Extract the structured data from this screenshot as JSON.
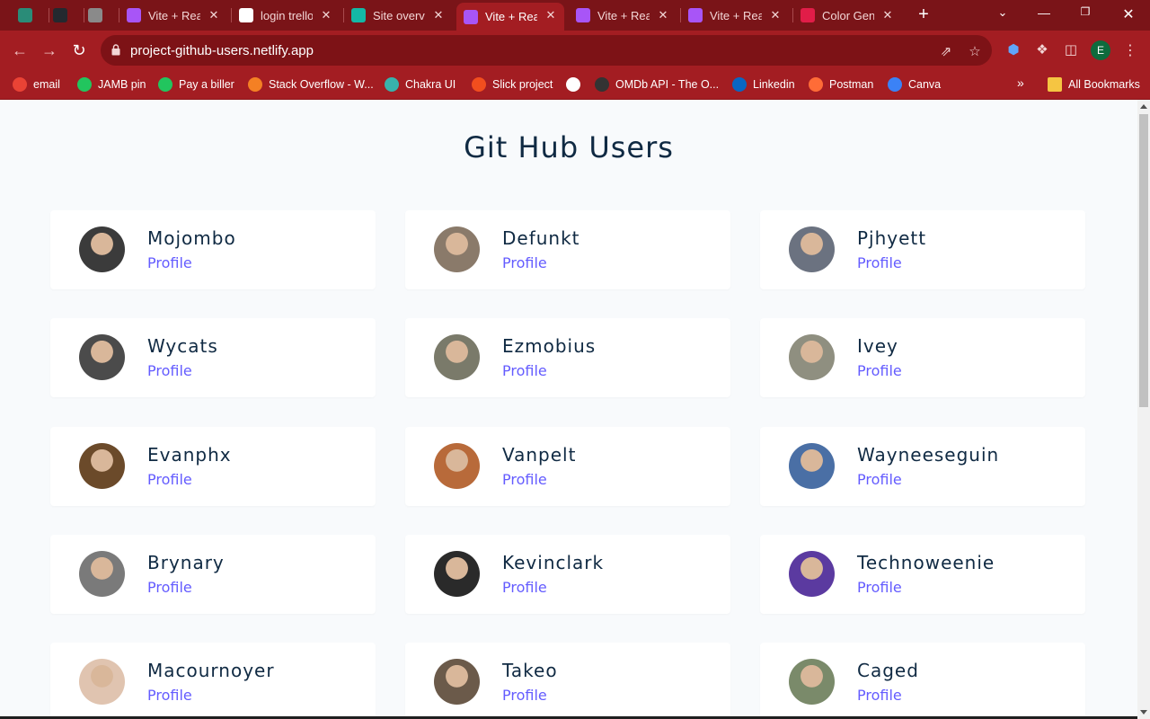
{
  "browser": {
    "tabs": [
      {
        "title": "",
        "icon": "chatgpt-icon",
        "color": "#2a8c78"
      },
      {
        "title": "",
        "icon": "github-icon",
        "color": "#24292f"
      },
      {
        "title": "",
        "icon": "app-icon",
        "color": "#8a8a8a"
      },
      {
        "title": "Vite + Reac",
        "icon": "vite-icon",
        "color": "#a855f7"
      },
      {
        "title": "login trello",
        "icon": "google-icon",
        "color": "#ffffff"
      },
      {
        "title": "Site overvie",
        "icon": "netlify-icon",
        "color": "#14b8a6"
      },
      {
        "title": "Vite + Reac",
        "icon": "vite-icon",
        "color": "#a855f7",
        "active": true
      },
      {
        "title": "Vite + Reac",
        "icon": "vite-icon",
        "color": "#a855f7"
      },
      {
        "title": "Vite + Reac",
        "icon": "vite-icon",
        "color": "#a855f7"
      },
      {
        "title": "Color Gene",
        "icon": "color-wheel-icon",
        "color": "#e11d48"
      }
    ],
    "url": "project-github-users.netlify.app",
    "profile_initial": "E",
    "bookmarks": [
      {
        "label": "email",
        "icon": "gmail-icon",
        "color": "#ea4335"
      },
      {
        "label": "JAMB pin",
        "icon": "jamb-icon",
        "color": "#22c55e"
      },
      {
        "label": "Pay a biller",
        "icon": "biller-icon",
        "color": "#22c55e"
      },
      {
        "label": "Stack Overflow - W...",
        "icon": "stackoverflow-icon",
        "color": "#f48024"
      },
      {
        "label": "Chakra UI",
        "icon": "chakra-icon",
        "color": "#38b2ac"
      },
      {
        "label": "Slick project",
        "icon": "figma-icon",
        "color": "#f24e1e"
      },
      {
        "label": "",
        "icon": "globe-icon",
        "color": "#ffffff"
      },
      {
        "label": "OMDb API - The O...",
        "icon": "omdb-icon",
        "color": "#333333"
      },
      {
        "label": "Linkedin",
        "icon": "linkedin-icon",
        "color": "#0a66c2"
      },
      {
        "label": "Postman",
        "icon": "postman-icon",
        "color": "#ff6c37"
      },
      {
        "label": "Canva",
        "icon": "canva-icon",
        "color": "#3b82f6"
      }
    ],
    "bookmarks_overflow": "»",
    "all_bookmarks": "All Bookmarks"
  },
  "page": {
    "title": "Git Hub Users",
    "link_label": "Profile",
    "users": [
      {
        "name": "Mojombo",
        "avatar_color": "#3b3b3b"
      },
      {
        "name": "Defunkt",
        "avatar_color": "#8a7a6a"
      },
      {
        "name": "Pjhyett",
        "avatar_color": "#6b7280"
      },
      {
        "name": "Wycats",
        "avatar_color": "#4b4b4b"
      },
      {
        "name": "Ezmobius",
        "avatar_color": "#7a7a6a"
      },
      {
        "name": "Ivey",
        "avatar_color": "#8f8f80"
      },
      {
        "name": "Evanphx",
        "avatar_color": "#6b4a2a"
      },
      {
        "name": "Vanpelt",
        "avatar_color": "#b86a3a"
      },
      {
        "name": "Wayneeseguin",
        "avatar_color": "#4a6fa5"
      },
      {
        "name": "Brynary",
        "avatar_color": "#7a7a7a"
      },
      {
        "name": "Kevinclark",
        "avatar_color": "#2a2a2a"
      },
      {
        "name": "Technoweenie",
        "avatar_color": "#5b3aa0"
      },
      {
        "name": "Macournoyer",
        "avatar_color": "#e0c4b0"
      },
      {
        "name": "Takeo",
        "avatar_color": "#6b5a4a"
      },
      {
        "name": "Caged",
        "avatar_color": "#7a8a6a"
      }
    ]
  },
  "colors": {
    "chrome_dark": "#7a1418",
    "chrome": "#a31d22",
    "link": "#645cff",
    "heading": "#102a43",
    "page_bg": "#f8fafc"
  }
}
